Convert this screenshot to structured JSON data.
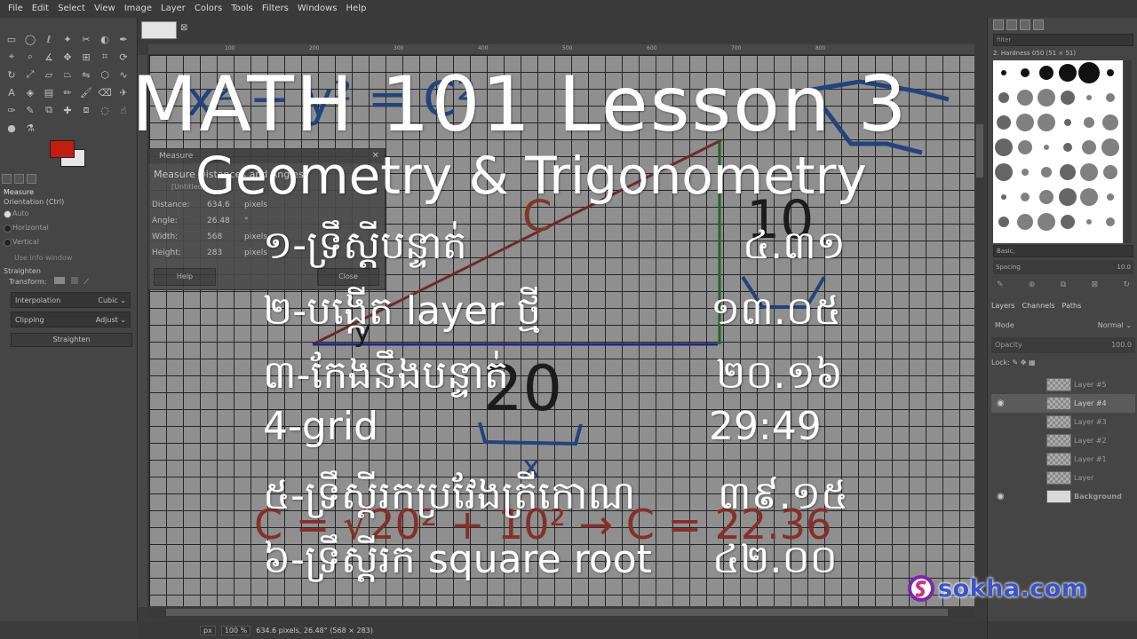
{
  "menu": [
    "File",
    "Edit",
    "Select",
    "View",
    "Image",
    "Layer",
    "Colors",
    "Tools",
    "Filters",
    "Windows",
    "Help"
  ],
  "tool_options": {
    "title": "Measure",
    "orientation": "Orientation  (Ctrl)",
    "radios": [
      "Auto",
      "Horizontal",
      "Vertical"
    ],
    "use_info_window": "Use info window",
    "straighten_label": "Straighten",
    "transform_label": "Transform:",
    "interpolation": {
      "label": "Interpolation",
      "value": "Cubic"
    },
    "clipping": {
      "label": "Clipping",
      "value": "Adjust"
    },
    "straighten_button": "Straighten"
  },
  "measure_dialog": {
    "title": "Measure",
    "heading": "Measure Distances and Angles",
    "sub": "[Untitled]",
    "rows": [
      {
        "label": "Distance:",
        "value": "634.6",
        "unit": "pixels"
      },
      {
        "label": "Angle:",
        "value": "26.48",
        "unit": "°"
      },
      {
        "label": "Width:",
        "value": "568",
        "unit": "pixels"
      },
      {
        "label": "Height:",
        "value": "283",
        "unit": "pixels"
      }
    ],
    "help": "Help",
    "close": "Close"
  },
  "rulers": [
    "100",
    "200",
    "300",
    "400",
    "500",
    "600",
    "700",
    "800"
  ],
  "status": {
    "unit": "px",
    "zoom": "100 %",
    "info": "634.6 pixels, 26.48° (568 × 283)"
  },
  "brushes": {
    "filter_placeholder": "filter",
    "name": "2. Hardness 050 (51 × 51)",
    "preset": "Basic,",
    "spacing_label": "Spacing",
    "spacing_value": "10.0"
  },
  "layers": {
    "tabs": [
      "Layers",
      "Channels",
      "Paths"
    ],
    "mode_label": "Mode",
    "mode_value": "Normal",
    "opacity_label": "Opacity",
    "opacity_value": "100.0",
    "lock_label": "Lock:",
    "items": [
      {
        "name": "Layer #5",
        "visible": false,
        "active": false
      },
      {
        "name": "Layer #4",
        "visible": true,
        "active": true
      },
      {
        "name": "Layer #3",
        "visible": false,
        "active": false
      },
      {
        "name": "Layer #2",
        "visible": false,
        "active": false
      },
      {
        "name": "Layer #1",
        "visible": false,
        "active": false
      },
      {
        "name": "Layer",
        "visible": false,
        "active": false
      },
      {
        "name": "Background",
        "visible": true,
        "active": false
      }
    ]
  },
  "overlay": {
    "title": "MATH 101 Lesson 3",
    "subtitle": "Geometry & Trigonometry",
    "items": [
      {
        "label": "១-ទ្រឹស្តីបន្ទាត់",
        "time": "៤.៣១"
      },
      {
        "label": "២-បង្កើត layer  ថ្មី",
        "time": "១៣.០៥"
      },
      {
        "label": "៣-កែងនឹងបន្ទាត់",
        "time": "២០.១៦"
      },
      {
        "label": "4-grid",
        "time": "29:49"
      },
      {
        "label": "៥-ទ្រឹស្តីរកប្រវែងត្រីកោណ",
        "time": "៣៩.១៥"
      },
      {
        "label": "៦-ទ្រឹស្តីរក square root",
        "time": "៤២.០០"
      }
    ]
  },
  "canvas_text": {
    "side_a": "20",
    "side_b": "10",
    "hyp_label": "C",
    "x_label": "x",
    "y_label": "y",
    "formula_top": "x² + y² = C²",
    "formula_bottom": "C = √20² + 10²  →  C = 22.36"
  },
  "brand": {
    "text": "sokha.com"
  },
  "colors": {
    "foreground": "#c21d12",
    "background": "#e6e6e6",
    "brand": "#3a54c8"
  }
}
